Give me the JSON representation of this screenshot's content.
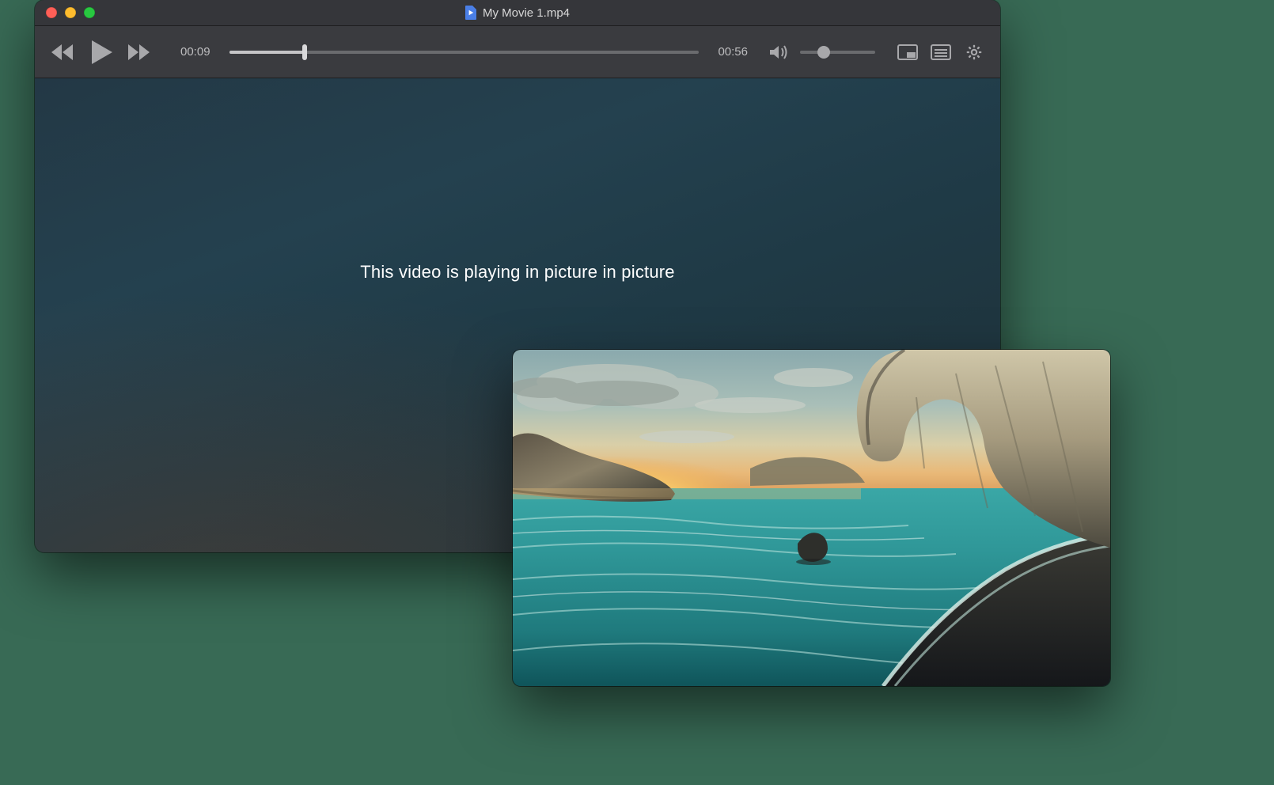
{
  "window": {
    "title": "My Movie 1.mp4"
  },
  "player": {
    "elapsed": "00:09",
    "duration": "00:56",
    "progress_percent": 16,
    "volume_percent": 32
  },
  "content": {
    "pip_message": "This video is playing in picture in picture"
  }
}
